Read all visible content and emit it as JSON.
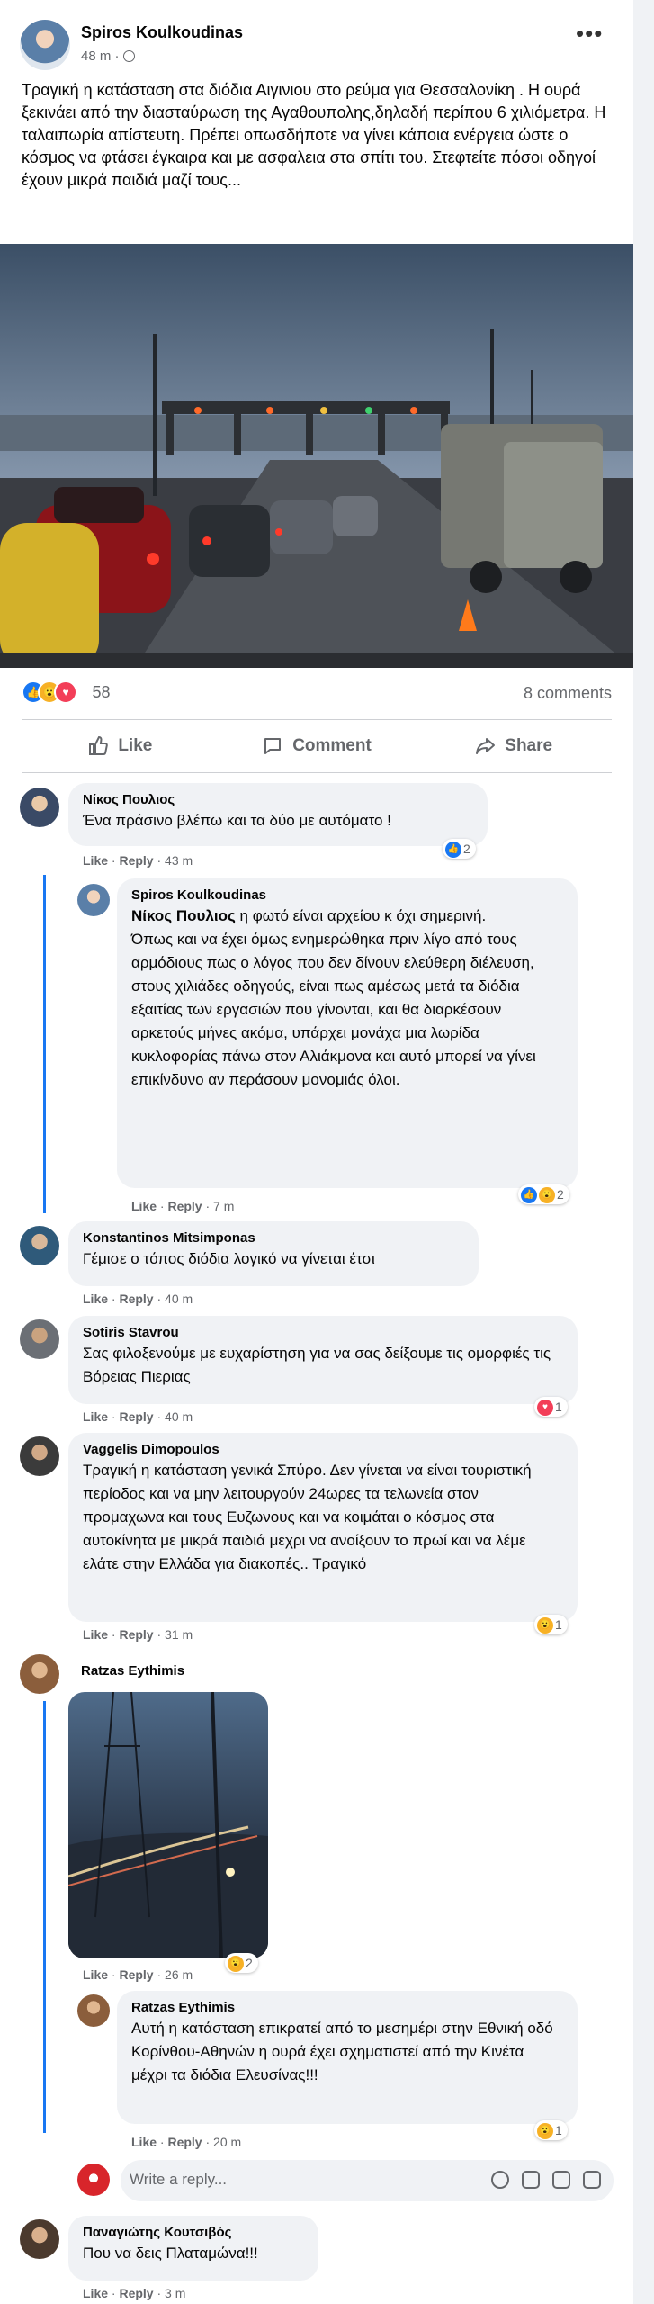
{
  "post": {
    "author": "Spiros Koulkoudinas",
    "time": "48 m",
    "more": "•••",
    "text": "Τραγική η κατάσταση στα διόδια Αιγινιου στο ρεύμα για Θεσσαλονίκη . Η ουρά ξεκινάει από την διασταύρωση της Αγαθουπολης,δηλαδή περίπου 6 χιλιόμετρα. Η ταλαιπωρία απίστευτη. Πρέπει οπωσδήποτε να γίνει κάποια ενέργεια ώστε ο κόσμος να φτάσει έγκαιρα και με ασφαλεια στα σπίτι του. Στεφτείτε πόσοι οδηγοί έχουν μικρά παιδιά μαζί τους...",
    "reaction_count": "58",
    "comments_count": "8 comments",
    "reaction_icons": [
      "like-icon",
      "wow-icon",
      "love-icon"
    ]
  },
  "actions": {
    "like": "Like",
    "comment": "Comment",
    "share": "Share"
  },
  "comment_meta": {
    "like": "Like",
    "reply": "Reply",
    "sep": " · "
  },
  "comments": [
    {
      "name": "Νίκος Πουλιος",
      "text": "Ένα πράσινο βλέπω και τα δύο με αυτόματο !",
      "time": "43 m",
      "reactions": "2"
    },
    {
      "name": "Spiros Koulkoudinas",
      "tag": "Νίκος Πουλιος",
      "text": " η φωτό είναι αρχείου κ όχι σημερινή.\nΌπως και να έχει όμως ενημερώθηκα πριν λίγο από τους αρμόδιους πως ο λόγος που δεν δίνουν ελεύθερη διέλευση, στους χιλιάδες οδηγούς, είναι πως αμέσως μετά τα διόδια εξαιτίας των εργασιών που γίνονται, και θα διαρκέσουν αρκετούς μήνες ακόμα, υπάρχει μονάχα μια λωρίδα κυκλοφορίας πάνω στον Αλιάκμονα και αυτό μπορεί να γίνει επικίνδυνο αν περάσουν μονομιάς όλοι.",
      "time": "7 m",
      "reactions": "2"
    },
    {
      "name": "Konstantinos Mitsimponas",
      "text": "Γέμισε ο τόπος διόδια λογικό να γίνεται έτσι",
      "time": "40 m"
    },
    {
      "name": "Sotiris Stavrou",
      "text": "Σας φιλοξενούμε με ευχαρίστηση για να σας δείξουμε τις ομορφιές τις Βόρειας Πιεριας",
      "time": "40 m",
      "reactions": "1"
    },
    {
      "name": "Vaggelis Dimopoulos",
      "text": "Τραγική η κατάσταση γενικά Σπύρο. Δεν γίνεται να είναι τουριστική περίοδος και να μην λειτουργούν 24ωρες τα τελωνεία στον προμαχωνα και τους Ευζωνους και να κοιμάται ο κόσμος στα αυτοκίνητα με μικρά παιδιά μεχρι να ανοίξουν το πρωί και να λέμε ελάτε στην Ελλάδα για διακοπές.. Τραγικό",
      "time": "31 m",
      "reactions": "1"
    },
    {
      "name": "Ratzas Eythimis",
      "time": "26 m",
      "reactions": "2"
    },
    {
      "name": "Ratzas Eythimis",
      "text": "Αυτή η κατάσταση επικρατεί από το μεσημέρι στην Εθνική οδό Κορίνθου-Αθηνών η ουρά έχει σχηματιστεί από την Κινέτα μέχρι τα διόδια Ελευσίνας!!!",
      "time": "20 m",
      "reactions": "1"
    },
    {
      "name": "Παναγιώτης Κουτσιβός",
      "text": "Που να δεις Πλαταμώνα!!!",
      "time": "3 m"
    }
  ],
  "reply_box": {
    "placeholder": "Write a reply..."
  },
  "colors": {
    "accent": "#1877f2",
    "bubble": "#f0f2f5",
    "meta": "#65676b"
  }
}
